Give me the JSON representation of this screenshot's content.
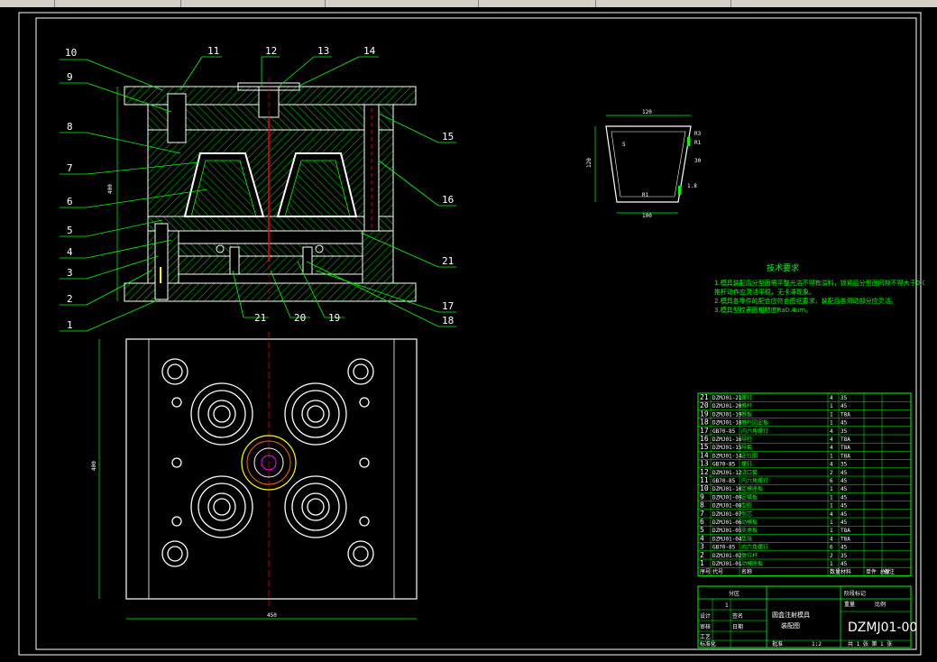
{
  "balloons": [
    "10",
    "11",
    "12",
    "13",
    "14",
    "9",
    "8",
    "7",
    "6",
    "5",
    "4",
    "3",
    "2",
    "1",
    "15",
    "16",
    "21",
    "17",
    "18",
    "21",
    "20",
    "19"
  ],
  "dims": {
    "front_height": "400",
    "plan_height": "400",
    "plan_width": "450",
    "part_top": "120",
    "part_bottom": "100",
    "part_height": "120",
    "part_5": "5",
    "part_30": "30",
    "part_r1": "R3",
    "part_r2": "R1",
    "part_small": "1.8",
    "part_inner": "R1"
  },
  "tech_req": {
    "title": "技术要求",
    "lines": [
      "1.模具装配后分型面需平整光洁不得有溢料，锁紧后分型面间隙不得大于0.02mm。",
      "   推杆动作应灵活平稳，无卡滞现象。",
      "2.模具各零件的配合应符合图纸要求，装配后各滑动部分应灵活。",
      "3.模具型腔表面粗糙度Ra0.4um。"
    ]
  },
  "bom": {
    "rows": [
      {
        "no": "21",
        "code": "DZMJ01-21",
        "name": "螺钉",
        "qty": "4",
        "mat": "35"
      },
      {
        "no": "20",
        "code": "DZMJ01-20",
        "name": "推杆",
        "qty": "1",
        "mat": "45"
      },
      {
        "no": "19",
        "code": "DZMJ01-19",
        "name": "推板",
        "qty": "1",
        "mat": "T8A"
      },
      {
        "no": "18",
        "code": "DZMJ01-18",
        "name": "推杆固定板",
        "qty": "1",
        "mat": "45"
      },
      {
        "no": "17",
        "code": "GB70-85",
        "name": "内六角螺钉",
        "qty": "4",
        "mat": "35"
      },
      {
        "no": "16",
        "code": "DZMJ01-16",
        "name": "导柱",
        "qty": "4",
        "mat": "T8A"
      },
      {
        "no": "15",
        "code": "DZMJ01-15",
        "name": "导套",
        "qty": "4",
        "mat": "T8A"
      },
      {
        "no": "14",
        "code": "DZMJ01-14",
        "name": "定位圈",
        "qty": "1",
        "mat": "T8A"
      },
      {
        "no": "13",
        "code": "GB70-85",
        "name": "螺钉",
        "qty": "4",
        "mat": "35"
      },
      {
        "no": "12",
        "code": "DZMJ01-12",
        "name": "浇口套",
        "qty": "2",
        "mat": "45"
      },
      {
        "no": "11",
        "code": "GB70-85",
        "name": "内六角螺钉",
        "qty": "6",
        "mat": "45"
      },
      {
        "no": "10",
        "code": "DZMJ01-10",
        "name": "定模座板",
        "qty": "1",
        "mat": "45"
      },
      {
        "no": "9",
        "code": "DZMJ01-09",
        "name": "定模板",
        "qty": "1",
        "mat": "45"
      },
      {
        "no": "8",
        "code": "DZMJ01-08",
        "name": "型腔",
        "qty": "1",
        "mat": "45"
      },
      {
        "no": "7",
        "code": "DZMJ01-07",
        "name": "型芯",
        "qty": "4",
        "mat": "45"
      },
      {
        "no": "6",
        "code": "DZMJ01-06",
        "name": "动模板",
        "qty": "1",
        "mat": "45"
      },
      {
        "no": "5",
        "code": "DZMJ01-05",
        "name": "支承板",
        "qty": "1",
        "mat": "T8A"
      },
      {
        "no": "4",
        "code": "DZMJ01-04",
        "name": "垫块",
        "qty": "4",
        "mat": "T8A"
      },
      {
        "no": "3",
        "code": "GB70-85",
        "name": "内六角螺钉",
        "qty": "6",
        "mat": "45"
      },
      {
        "no": "2",
        "code": "DZMJ01-02",
        "name": "复位杆",
        "qty": "2",
        "mat": "35"
      },
      {
        "no": "1",
        "code": "DZMJ01-01",
        "name": "动模座板",
        "qty": "1",
        "mat": "45"
      }
    ],
    "header": {
      "no": "序号",
      "code": "代号",
      "name": "名称",
      "qty": "数量",
      "mat": "材料",
      "weight": "单件 总计",
      "note": "备注"
    }
  },
  "title_block": {
    "dwg_no": "DZMJ01-00",
    "name": "圆盒注射模具",
    "subname": "装配图",
    "scale": "1:2",
    "sheet": "共 1 张 第 1 张",
    "stage": "阶段标记",
    "weight": "重量",
    "ratio": "比例",
    "designer": "设计",
    "checker": "审核",
    "process": "工艺",
    "approve": "批准",
    "std": "标准化",
    "date": "日期",
    "sign": "签名",
    "num": "1",
    "part": "分区"
  },
  "colors": {
    "frame": "#ffffff",
    "green": "#00ff00",
    "cyan": "#00ffff",
    "red": "#ff0000",
    "yellow": "#ffff00",
    "white": "#ffffff"
  }
}
